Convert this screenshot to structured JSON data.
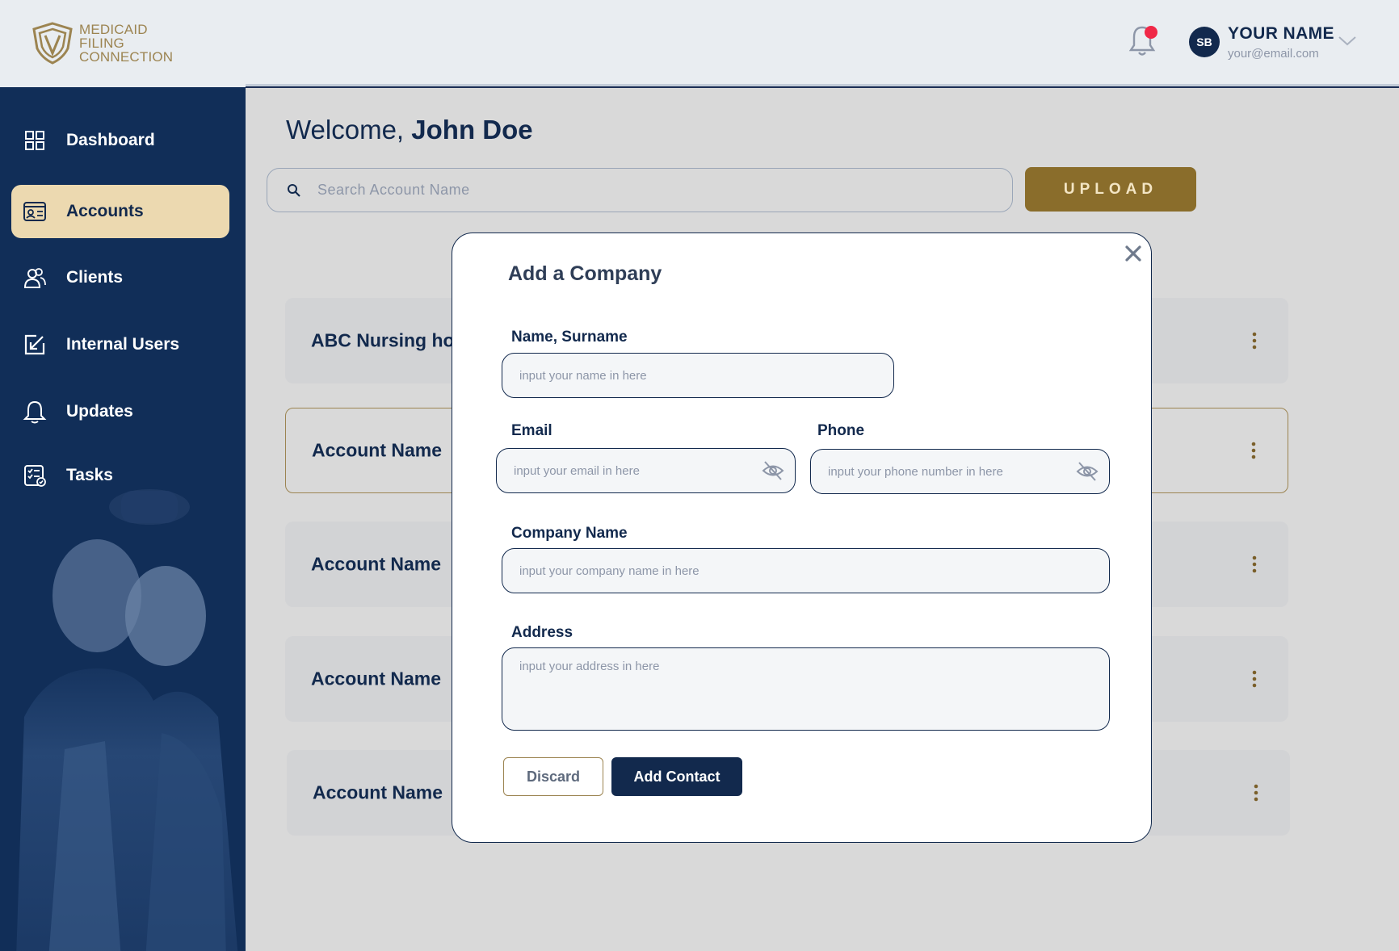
{
  "brand": {
    "logo_lines": [
      "MEDICAID",
      "FILING",
      "CONNECTION"
    ],
    "logo_icon": "shield-icon",
    "colors": {
      "navy": "#12294d",
      "gold": "#8a6d2b",
      "active_bg": "#ecd9b0",
      "notification": "#f02847"
    }
  },
  "header": {
    "notification_icon": "bell-icon",
    "has_notification": true,
    "user": {
      "initials": "SB",
      "name": "YOUR NAME",
      "email": "your@email.com"
    }
  },
  "sidebar": {
    "items": [
      {
        "label": "Dashboard",
        "icon": "grid-icon",
        "active": false
      },
      {
        "label": "Accounts",
        "icon": "id-card-icon",
        "active": true
      },
      {
        "label": "Clients",
        "icon": "users-icon",
        "active": false
      },
      {
        "label": "Internal Users",
        "icon": "edit-box-icon",
        "active": false
      },
      {
        "label": "Updates",
        "icon": "bell-icon",
        "active": false
      },
      {
        "label": "Tasks",
        "icon": "checklist-icon",
        "active": false
      }
    ]
  },
  "main": {
    "welcome_prefix": "Welcome, ",
    "welcome_name": "John Doe",
    "search_placeholder": "Search Account Name",
    "upload_label": "UPLOAD",
    "accounts": [
      {
        "name": "ABC Nursing home"
      },
      {
        "name": "Account Name"
      },
      {
        "name": "Account Name"
      },
      {
        "name": "Account Name"
      },
      {
        "name": "Account Name"
      }
    ]
  },
  "modal": {
    "title": "Add a Company",
    "fields": {
      "name": {
        "label": "Name, Surname",
        "placeholder": "input your name in here"
      },
      "email": {
        "label": "Email",
        "placeholder": "input your email in here"
      },
      "phone": {
        "label": "Phone",
        "placeholder": "input your phone number in here"
      },
      "company": {
        "label": "Company Name",
        "placeholder": "input your company name in here"
      },
      "address": {
        "label": "Address",
        "placeholder": "input your address in here"
      }
    },
    "discard_label": "Discard",
    "submit_label": "Add Contact"
  }
}
